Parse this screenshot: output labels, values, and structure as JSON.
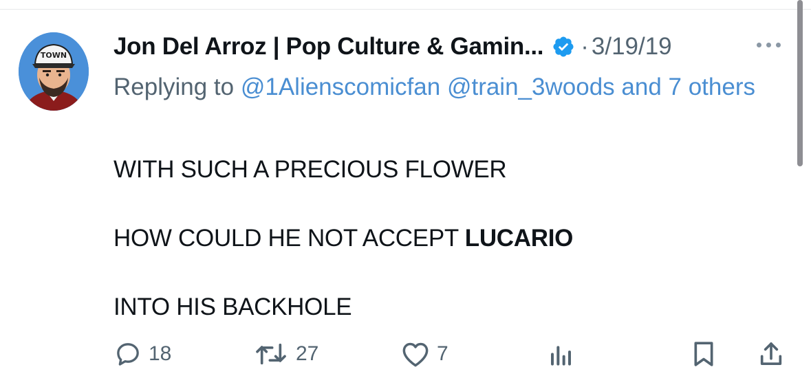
{
  "tweet": {
    "author": {
      "display_name": "Jon Del Arroz | Pop Culture & Gamin...",
      "verified": true,
      "avatar_hat_text": "TOWN"
    },
    "separator": "·",
    "date": "3/19/19",
    "reply": {
      "prefix": "Replying to ",
      "mention_1": "@1Alienscomicfan",
      "mention_2": "@train_3woods",
      "others": "and 7 others"
    },
    "text_lines": [
      {
        "before": "WITH SUCH A PRECIOUS FLOWER"
      },
      {
        "before": "HOW COULD HE NOT ACCEPT ",
        "bold": "LUCARIO"
      },
      {
        "before": "INTO HIS BACKHOLE"
      }
    ],
    "actions": {
      "replies": "18",
      "retweets": "27",
      "likes": "7"
    }
  },
  "colors": {
    "text": "#0f1419",
    "secondary": "#536471",
    "link": "#4a8ed2",
    "verified": "#1d9bf0"
  }
}
